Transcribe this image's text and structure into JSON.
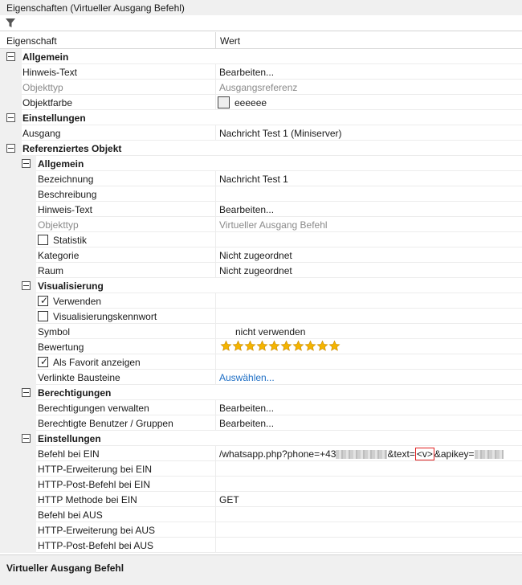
{
  "window": {
    "title": "Eigenschaften (Virtueller Ausgang Befehl)"
  },
  "toolbar": {
    "filter_icon": "filter-icon"
  },
  "header": {
    "col_property": "Eigenschaft",
    "col_value": "Wert"
  },
  "rows": [
    {
      "name": "Allgemein",
      "kind": "cat"
    },
    {
      "name": "Hinweis-Text",
      "value": "Bearbeiten..."
    },
    {
      "name": "Objekttyp",
      "value": "Ausgangsreferenz"
    },
    {
      "name": "Objektfarbe",
      "value": "eeeeee"
    },
    {
      "name": "Einstellungen",
      "kind": "cat"
    },
    {
      "name": "Ausgang",
      "value": "Nachricht Test 1 (Miniserver)"
    },
    {
      "name": "Referenziertes Objekt",
      "kind": "cat"
    },
    {
      "name": "Allgemein",
      "kind": "cat"
    },
    {
      "name": "Bezeichnung",
      "value": "Nachricht Test 1"
    },
    {
      "name": "Beschreibung",
      "value": ""
    },
    {
      "name": "Hinweis-Text",
      "value": "Bearbeiten..."
    },
    {
      "name": "Objekttyp",
      "value": "Virtueller Ausgang Befehl"
    },
    {
      "name": "Statistik",
      "checked": false
    },
    {
      "name": "Kategorie",
      "value": "Nicht zugeordnet"
    },
    {
      "name": "Raum",
      "value": "Nicht zugeordnet"
    },
    {
      "name": "Visualisierung",
      "kind": "cat"
    },
    {
      "name": "Verwenden",
      "checked": true
    },
    {
      "name": "Visualisierungskennwort",
      "checked": false
    },
    {
      "name": "Symbol",
      "value": "nicht verwenden"
    },
    {
      "name": "Bewertung",
      "stars": 10,
      "max_stars": 10
    },
    {
      "name": "Als Favorit anzeigen",
      "checked": true
    },
    {
      "name": "Verlinkte Bausteine",
      "value": "Auswählen..."
    },
    {
      "name": "Berechtigungen",
      "kind": "cat"
    },
    {
      "name": "Berechtigungen verwalten",
      "value": "Bearbeiten..."
    },
    {
      "name": "Berechtigte Benutzer / Gruppen",
      "value": "Bearbeiten..."
    },
    {
      "name": "Einstellungen",
      "kind": "cat"
    },
    {
      "name": "Befehl bei EIN",
      "value_parts": [
        "/whatsapp.php?phone=+43",
        "&text=",
        "<v>",
        "&apikey="
      ]
    },
    {
      "name": "HTTP-Erweiterung bei EIN",
      "value": ""
    },
    {
      "name": "HTTP-Post-Befehl bei EIN",
      "value": ""
    },
    {
      "name": "HTTP Methode bei EIN",
      "value": "GET"
    },
    {
      "name": "Befehl bei AUS",
      "value": ""
    },
    {
      "name": "HTTP-Erweiterung bei AUS",
      "value": ""
    },
    {
      "name": "HTTP-Post-Befehl bei AUS",
      "value": ""
    }
  ],
  "footer": {
    "description_title": "Virtueller Ausgang Befehl"
  },
  "colors": {
    "link": "#1f6fc5",
    "star": "#f4b400",
    "highlight_box": "#e02020",
    "grid_gutter": "#f0f0f0"
  }
}
